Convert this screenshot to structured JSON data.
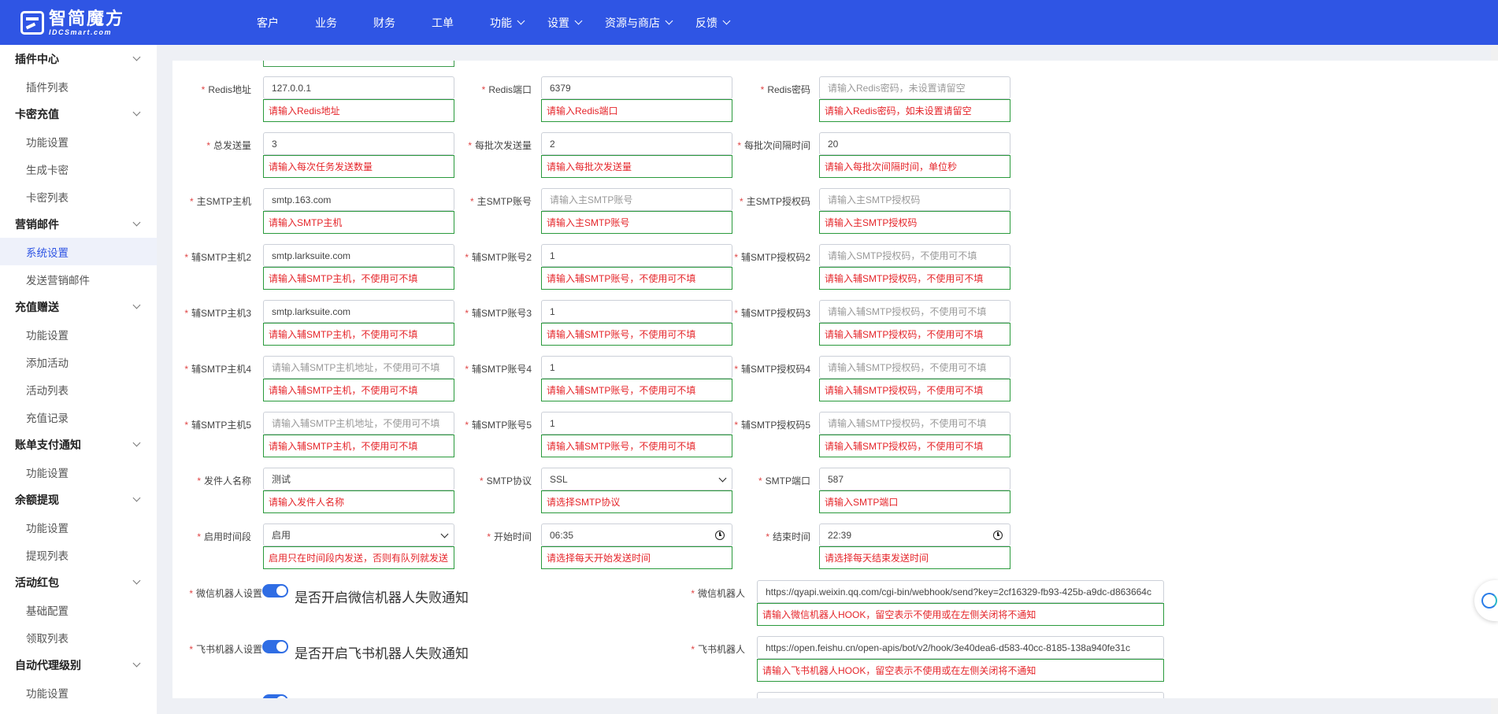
{
  "app": {
    "logo_cn": "智简魔方",
    "logo_en": "IDCSmart.com"
  },
  "nav": [
    {
      "label": "客户",
      "dropdown": false
    },
    {
      "label": "业务",
      "dropdown": false
    },
    {
      "label": "财务",
      "dropdown": false
    },
    {
      "label": "工单",
      "dropdown": false
    },
    {
      "label": "功能",
      "dropdown": true
    },
    {
      "label": "设置",
      "dropdown": true
    },
    {
      "label": "资源与商店",
      "dropdown": true
    },
    {
      "label": "反馈",
      "dropdown": true
    }
  ],
  "sidebar": [
    {
      "type": "group",
      "label": "插件中心"
    },
    {
      "type": "item",
      "label": "插件列表"
    },
    {
      "type": "group",
      "label": "卡密充值"
    },
    {
      "type": "item",
      "label": "功能设置"
    },
    {
      "type": "item",
      "label": "生成卡密"
    },
    {
      "type": "item",
      "label": "卡密列表"
    },
    {
      "type": "group",
      "label": "营销邮件"
    },
    {
      "type": "item",
      "label": "系统设置",
      "active": true
    },
    {
      "type": "item",
      "label": "发送营销邮件"
    },
    {
      "type": "group",
      "label": "充值赠送"
    },
    {
      "type": "item",
      "label": "功能设置"
    },
    {
      "type": "item",
      "label": "添加活动"
    },
    {
      "type": "item",
      "label": "活动列表"
    },
    {
      "type": "item",
      "label": "充值记录"
    },
    {
      "type": "group",
      "label": "账单支付通知"
    },
    {
      "type": "item",
      "label": "功能设置"
    },
    {
      "type": "group",
      "label": "余额提现"
    },
    {
      "type": "item",
      "label": "功能设置"
    },
    {
      "type": "item",
      "label": "提现列表"
    },
    {
      "type": "group",
      "label": "活动红包"
    },
    {
      "type": "item",
      "label": "基础配置"
    },
    {
      "type": "item",
      "label": "领取列表"
    },
    {
      "type": "group",
      "label": "自动代理级别"
    },
    {
      "type": "item",
      "label": "功能设置"
    }
  ],
  "form": {
    "rows": [
      [
        {
          "label": "Redis地址",
          "value": "127.0.0.1",
          "placeholder": false,
          "error": "请输入Redis地址"
        },
        {
          "label": "Redis端口",
          "value": "6379",
          "placeholder": false,
          "error": "请输入Redis端口"
        },
        {
          "label": "Redis密码",
          "value": "请输入Redis密码，未设置请留空",
          "placeholder": true,
          "error": "请输入Redis密码，如未设置请留空"
        }
      ],
      [
        {
          "label": "总发送量",
          "value": "3",
          "placeholder": false,
          "error": "请输入每次任务发送数量"
        },
        {
          "label": "每批次发送量",
          "value": "2",
          "placeholder": false,
          "error": "请输入每批次发送量"
        },
        {
          "label": "每批次间隔时间",
          "value": "20",
          "placeholder": false,
          "error": "请输入每批次间隔时间，单位秒"
        }
      ],
      [
        {
          "label": "主SMTP主机",
          "value": "smtp.163.com",
          "placeholder": false,
          "error": "请输入SMTP主机"
        },
        {
          "label": "主SMTP账号",
          "value": "请输入主SMTP账号",
          "placeholder": true,
          "error": "请输入主SMTP账号"
        },
        {
          "label": "主SMTP授权码",
          "value": "请输入主SMTP授权码",
          "placeholder": true,
          "error": "请输入主SMTP授权码"
        }
      ],
      [
        {
          "label": "辅SMTP主机2",
          "value": "smtp.larksuite.com",
          "placeholder": false,
          "error": "请输入辅SMTP主机，不使用可不填"
        },
        {
          "label": "辅SMTP账号2",
          "value": "1",
          "placeholder": false,
          "error": "请输入辅SMTP账号，不使用可不填"
        },
        {
          "label": "辅SMTP授权码2",
          "value": "请输入SMTP授权码，不使用可不填",
          "placeholder": true,
          "error": "请输入辅SMTP授权码，不使用可不填"
        }
      ],
      [
        {
          "label": "辅SMTP主机3",
          "value": "smtp.larksuite.com",
          "placeholder": false,
          "error": "请输入辅SMTP主机，不使用可不填"
        },
        {
          "label": "辅SMTP账号3",
          "value": "1",
          "placeholder": false,
          "error": "请输入辅SMTP账号，不使用可不填"
        },
        {
          "label": "辅SMTP授权码3",
          "value": "请输入辅SMTP授权码，不使用可不填",
          "placeholder": true,
          "error": "请输入辅SMTP授权码，不使用可不填"
        }
      ],
      [
        {
          "label": "辅SMTP主机4",
          "value": "请输入辅SMTP主机地址，不使用可不填",
          "placeholder": true,
          "error": "请输入辅SMTP主机，不使用可不填"
        },
        {
          "label": "辅SMTP账号4",
          "value": "1",
          "placeholder": false,
          "error": "请输入辅SMTP账号，不使用可不填"
        },
        {
          "label": "辅SMTP授权码4",
          "value": "请输入辅SMTP授权码，不使用可不填",
          "placeholder": true,
          "error": "请输入辅SMTP授权码，不使用可不填"
        }
      ],
      [
        {
          "label": "辅SMTP主机5",
          "value": "请输入辅SMTP主机地址，不使用可不填",
          "placeholder": true,
          "error": "请输入辅SMTP主机，不使用可不填"
        },
        {
          "label": "辅SMTP账号5",
          "value": "1",
          "placeholder": false,
          "error": "请输入辅SMTP账号，不使用可不填"
        },
        {
          "label": "辅SMTP授权码5",
          "value": "请输入辅SMTP授权码，不使用可不填",
          "placeholder": true,
          "error": "请输入辅SMTP授权码，不使用可不填"
        }
      ],
      [
        {
          "label": "发件人名称",
          "value": "测试",
          "placeholder": false,
          "error": "请输入发件人名称"
        },
        {
          "label": "SMTP协议",
          "value": "SSL",
          "placeholder": false,
          "kind": "select",
          "error": "请选择SMTP协议"
        },
        {
          "label": "SMTP端口",
          "value": "587",
          "placeholder": false,
          "error": "请输入SMTP端口"
        }
      ],
      [
        {
          "label": "启用时间段",
          "value": "启用",
          "placeholder": false,
          "kind": "select",
          "error": "启用只在时间段内发送，否则有队列就发送"
        },
        {
          "label": "开始时间",
          "value": "06:35",
          "placeholder": false,
          "kind": "time",
          "error": "请选择每天开始发送时间"
        },
        {
          "label": "结束时间",
          "value": "22:39",
          "placeholder": false,
          "kind": "time",
          "error": "请选择每天结束发送时间"
        }
      ]
    ],
    "robots": [
      {
        "toggle_label": "微信机器人设置",
        "toggle_text": "是否开启微信机器人失败通知",
        "enabled": true,
        "hook_label": "微信机器人",
        "hook_value": "https://qyapi.weixin.qq.com/cgi-bin/webhook/send?key=2cf16329-fb93-425b-a9dc-d863664c",
        "hook_error": "请输入微信机器人HOOK，留空表示不使用或在左侧关闭将不通知"
      },
      {
        "toggle_label": "飞书机器人设置",
        "toggle_text": "是否开启飞书机器人失败通知",
        "enabled": true,
        "hook_label": "飞书机器人",
        "hook_value": "https://open.feishu.cn/open-apis/bot/v2/hook/3e40dea6-d583-40cc-8185-138a940fe31c",
        "hook_error": "请输入飞书机器人HOOK，留空表示不使用或在左侧关闭将不通知"
      }
    ]
  }
}
